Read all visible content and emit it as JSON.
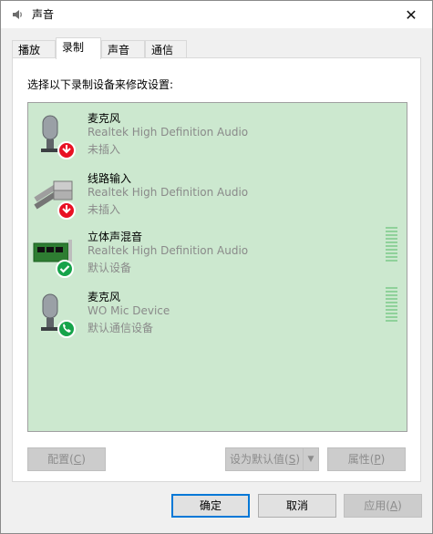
{
  "window": {
    "title": "声音",
    "close_icon": "close-icon"
  },
  "tabs": [
    {
      "label": "播放",
      "active": false
    },
    {
      "label": "录制",
      "active": true
    },
    {
      "label": "声音",
      "active": false
    },
    {
      "label": "通信",
      "active": false
    }
  ],
  "panel": {
    "instruction": "选择以下录制设备来修改设置:",
    "devices": [
      {
        "name": "麦克风",
        "driver": "Realtek High Definition Audio",
        "status": "未插入",
        "icon": "microphone-icon",
        "badge": "unplugged-badge-icon",
        "meter": false
      },
      {
        "name": "线路输入",
        "driver": "Realtek High Definition Audio",
        "status": "未插入",
        "icon": "line-in-icon",
        "badge": "unplugged-badge-icon",
        "meter": false
      },
      {
        "name": "立体声混音",
        "driver": "Realtek High Definition Audio",
        "status": "默认设备",
        "icon": "sound-card-icon",
        "badge": "default-check-icon",
        "meter": true
      },
      {
        "name": "麦克风",
        "driver": "WO Mic Device",
        "status": "默认通信设备",
        "icon": "microphone-icon",
        "badge": "phone-badge-icon",
        "meter": true
      }
    ],
    "buttons": {
      "configure": {
        "label": "配置(",
        "key": "C",
        "tail": ")"
      },
      "set_default": {
        "label": "设为默认值(",
        "key": "S",
        "tail": ")"
      },
      "properties": {
        "label": "属性(",
        "key": "P",
        "tail": ")"
      }
    }
  },
  "footer": {
    "ok": "确定",
    "cancel": "取消",
    "apply": {
      "label": "应用(",
      "key": "A",
      "tail": ")"
    }
  },
  "colors": {
    "list_bg": "#cce8cf",
    "accent": "#0078d7",
    "badge_red": "#e81123",
    "badge_green": "#16a34a"
  }
}
